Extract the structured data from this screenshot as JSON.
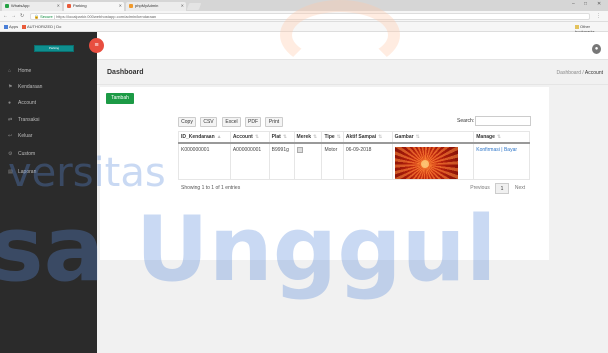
{
  "browser": {
    "tabs": [
      {
        "label": "WhatsApp",
        "color": "#25a244"
      },
      {
        "label": "Parking",
        "color": "#e95b3a"
      },
      {
        "label": "phpMyAdmin",
        "color": "#f09a2c"
      }
    ],
    "address": {
      "secure": "Secure",
      "url": "https://localparkir.000webhostapp.com/admin/kendaraan"
    },
    "bookmarks": [
      {
        "label": "Apps",
        "color": "#4a7fd8"
      },
      {
        "label": "AUTHORIZED | Do",
        "color": "#e95b3a"
      }
    ],
    "other_bookmarks": "Other bookmarks"
  },
  "app": {
    "logo_text": "Parking",
    "menu_toggle_icon": "menu-icon",
    "sidebar": [
      {
        "label": "Home",
        "icon": "home-icon",
        "glyph": "⌂"
      },
      {
        "label": "Kendaraan",
        "icon": "car-icon",
        "glyph": "⚑"
      },
      {
        "label": "Account",
        "icon": "user-icon",
        "glyph": "●"
      },
      {
        "label": "Transaksi",
        "icon": "exchange-icon",
        "glyph": "⇄"
      },
      {
        "label": "Keluar",
        "icon": "logout-icon",
        "glyph": "↩"
      },
      {
        "label": "Custom",
        "icon": "settings-icon",
        "glyph": "⚙"
      },
      {
        "label": "Laporan",
        "icon": "report-icon",
        "glyph": "▤"
      }
    ]
  },
  "page": {
    "title": "Dashboard",
    "breadcrumb": {
      "home": "Dashboard",
      "sep": "/",
      "current": "Account"
    },
    "add_button": "Tambah",
    "export_buttons": [
      "Copy",
      "CSV",
      "Excel",
      "PDF",
      "Print"
    ],
    "search_label": "Search:",
    "search_value": "",
    "table": {
      "columns": [
        "ID_Kendaraan",
        "Account",
        "Plat",
        "Merek",
        "Tipe",
        "Aktif Sampai",
        "Gambar",
        "Manage"
      ],
      "rows": [
        {
          "id": "K000000001",
          "account": "A000000001",
          "plat": "B9991g",
          "tipe": "Motor",
          "aktif": "06-09-2018",
          "manage_confirm": "Konfirmasi",
          "manage_sep": "|",
          "manage_pay": "Bayar"
        }
      ]
    },
    "info": "Showing 1 to 1 of 1 entries",
    "pagination": {
      "prev": "Previous",
      "current": "1",
      "next": "Next"
    }
  },
  "watermark": {
    "line1": "versitas",
    "line2": "sa Unggul"
  }
}
